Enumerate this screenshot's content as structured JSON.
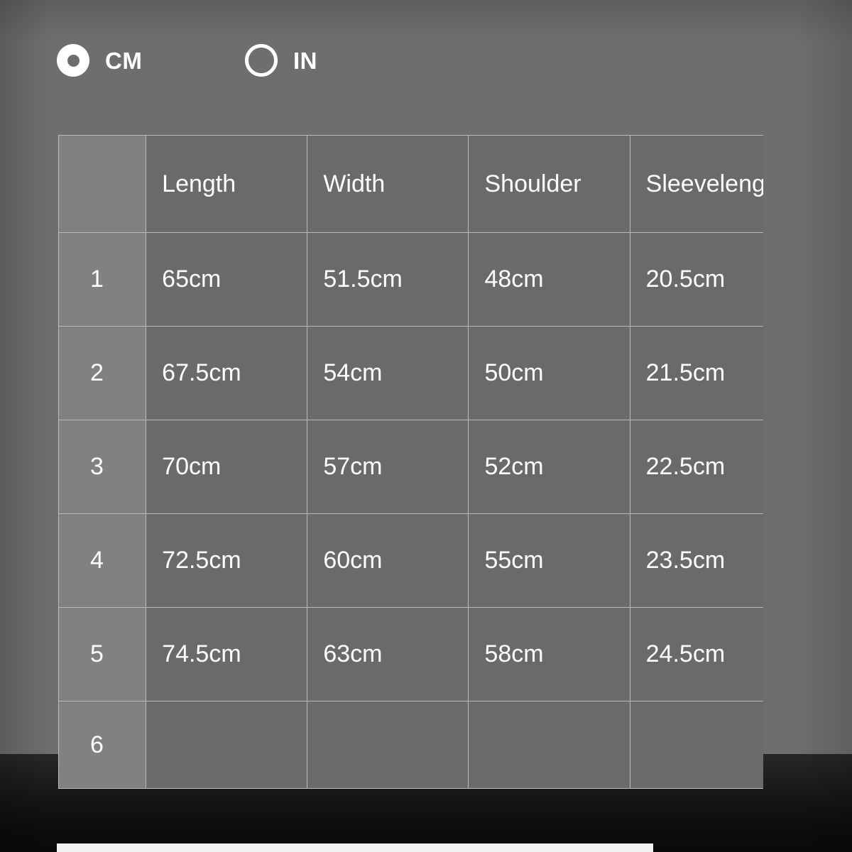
{
  "unit_selector": {
    "options": [
      {
        "label": "CM",
        "value": "cm",
        "selected": true,
        "icon": "radio-selected-icon"
      },
      {
        "label": "IN",
        "value": "in",
        "selected": false,
        "icon": "radio-unselected-icon"
      }
    ]
  },
  "size_table": {
    "index_header": "",
    "headers": [
      "Length",
      "Width",
      "Shoulder",
      "Sleevelength"
    ],
    "rows": [
      {
        "index": "1",
        "values": [
          "65cm",
          "51.5cm",
          "48cm",
          "20.5cm",
          ""
        ]
      },
      {
        "index": "2",
        "values": [
          "67.5cm",
          "54cm",
          "50cm",
          "21.5cm",
          ""
        ]
      },
      {
        "index": "3",
        "values": [
          "70cm",
          "57cm",
          "52cm",
          "22.5cm",
          ""
        ]
      },
      {
        "index": "4",
        "values": [
          "72.5cm",
          "60cm",
          "55cm",
          "23.5cm",
          ""
        ]
      },
      {
        "index": "5",
        "values": [
          "74.5cm",
          "63cm",
          "58cm",
          "24.5cm",
          ""
        ]
      },
      {
        "index": "6",
        "values": [
          "",
          "",
          "",
          "",
          ""
        ]
      }
    ]
  },
  "colors": {
    "background": "#6e6e6e",
    "cell_background": "#6a6a6a",
    "index_cell_background": "#818181",
    "grid_line": "#b9b9b9",
    "text": "#ffffff",
    "bottom_bar": "#f2f2f2"
  }
}
